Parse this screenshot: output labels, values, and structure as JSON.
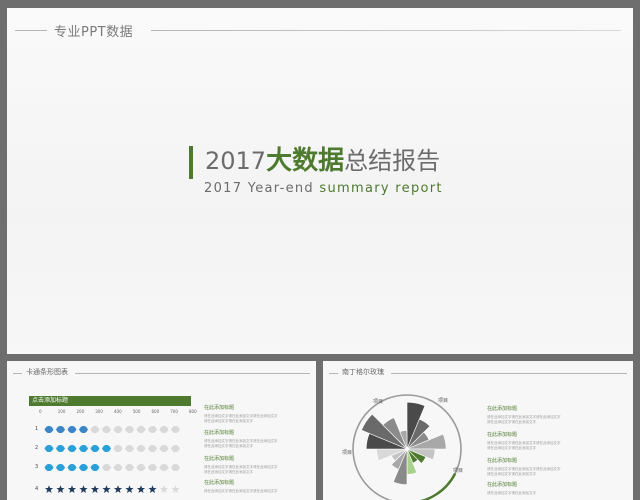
{
  "main_slide": {
    "brand_label": "专业PPT数据",
    "title_prefix": "2017",
    "title_highlight": "大数据",
    "title_suffix": "总结报告",
    "subtitle_prefix": "2017 Year-end ",
    "subtitle_highlight": "summary report",
    "accent_color": "#4e7a2f"
  },
  "thumb_left": {
    "label": "卡通条形图表",
    "header_title": "点击添加标题",
    "axis_ticks": [
      "0",
      "100",
      "200",
      "300",
      "400",
      "500",
      "600",
      "700",
      "800"
    ],
    "rows": [
      {
        "index": "1",
        "filled": 4,
        "total": 12,
        "color": "#3a86c8"
      },
      {
        "index": "2",
        "filled": 6,
        "total": 12,
        "color": "#2aa0d8"
      },
      {
        "index": "3",
        "filled": 5,
        "total": 12,
        "color": "#2aa0d8"
      },
      {
        "index": "4",
        "filled": 10,
        "total": 12,
        "color": "#1e3a5c"
      }
    ],
    "text_blocks": [
      {
        "title": "在此添加标题",
        "lines": [
          "请在此添加文字请在此添加文字请在此添加文字",
          "请在此添加文字请在此添加文字"
        ]
      },
      {
        "title": "在此添加标题",
        "lines": [
          "请在此添加文字请在此添加文字请在此添加文字",
          "请在此添加文字请在此添加文字"
        ]
      },
      {
        "title": "在此添加标题",
        "lines": [
          "请在此添加文字请在此添加文字请在此添加文字",
          "请在此添加文字请在此添加文字"
        ]
      },
      {
        "title": "在此添加标题",
        "lines": [
          "请在此添加文字请在此添加文字请在此添加文字"
        ]
      }
    ]
  },
  "thumb_right": {
    "label": "南丁格尔玫瑰",
    "rose_labels": [
      "项目",
      "项目",
      "项目",
      "项目"
    ],
    "wedge_values": [
      55,
      38,
      28,
      46,
      33,
      24,
      18,
      30,
      42,
      26,
      20,
      36,
      48,
      58,
      40,
      22
    ],
    "highlight_color": "#4e7a2f",
    "text_blocks": [
      {
        "title": "在此添加标题",
        "lines": [
          "请在此添加文字请在此添加文字请在此添加文字",
          "请在此添加文字请在此添加文字"
        ]
      },
      {
        "title": "在此添加标题",
        "lines": [
          "请在此添加文字请在此添加文字请在此添加文字",
          "请在此添加文字请在此添加文字"
        ]
      },
      {
        "title": "在此添加标题",
        "lines": [
          "请在此添加文字请在此添加文字请在此添加文字",
          "请在此添加文字请在此添加文字"
        ]
      },
      {
        "title": "在此添加标题",
        "lines": [
          "请在此添加文字请在此添加文字"
        ]
      }
    ]
  }
}
